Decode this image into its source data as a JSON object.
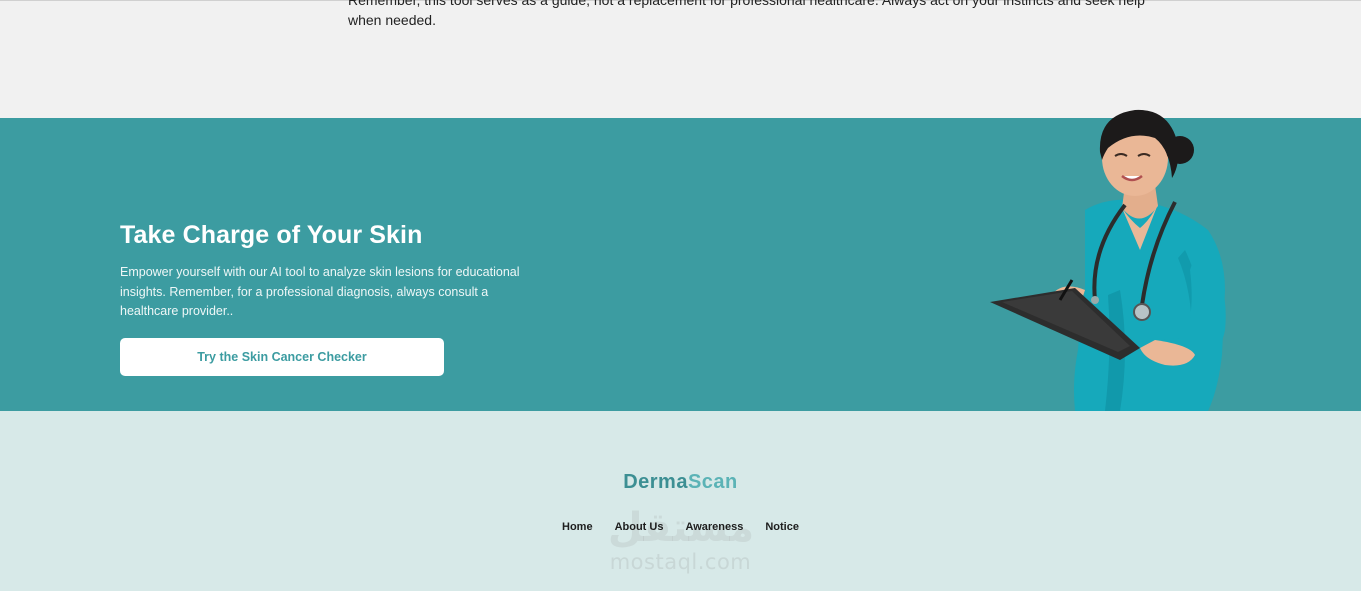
{
  "top_section": {
    "text": "Remember, this tool serves as a guide, not a replacement for professional healthcare. Always act on your instincts and seek help when needed."
  },
  "cta": {
    "heading": "Take Charge of Your Skin",
    "text": "Empower yourself with our AI tool to analyze skin lesions for educational insights. Remember, for a professional diagnosis, always consult a healthcare provider..",
    "button_label": "Try the Skin Cancer Checker",
    "background_color": "#3c9ca1",
    "image": "nurse-with-clipboard-illustration"
  },
  "footer": {
    "brand_dark": "Derma",
    "brand_light": "Scan",
    "nav": [
      {
        "label": "Home"
      },
      {
        "label": "About Us"
      },
      {
        "label": "Awareness"
      },
      {
        "label": "Notice"
      }
    ],
    "background_color": "#d7e9e8",
    "watermark_arabic": "مستقل",
    "watermark_latin": "mostaql.com"
  }
}
